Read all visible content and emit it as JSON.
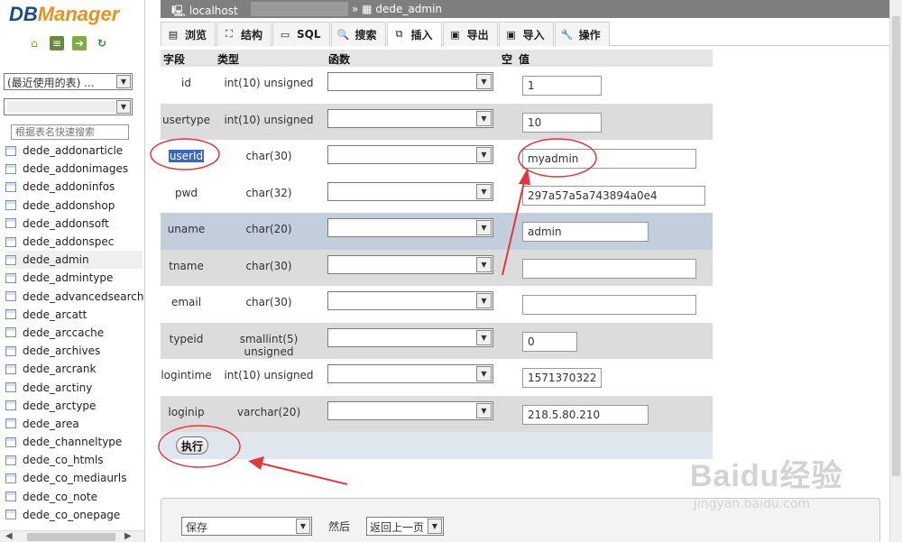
{
  "app": {
    "logo_db": "DB",
    "logo_manager": "Manager"
  },
  "sidebar": {
    "recent_select": "(最近使用的表) ...",
    "db_select": "",
    "search_placeholder": "根据表名快速搜索",
    "tables": [
      "dede_addonarticle",
      "dede_addonimages",
      "dede_addoninfos",
      "dede_addonshop",
      "dede_addonsoft",
      "dede_addonspec",
      "dede_admin",
      "dede_admintype",
      "dede_advancedsearch",
      "dede_arcatt",
      "dede_arccache",
      "dede_archives",
      "dede_arcrank",
      "dede_arctiny",
      "dede_arctype",
      "dede_area",
      "dede_channeltype",
      "dede_co_htmls",
      "dede_co_mediaurls",
      "dede_co_note",
      "dede_co_onepage"
    ],
    "active_table": "dede_admin"
  },
  "breadcrumb": {
    "server": "localhost",
    "table": "dede_admin",
    "sep": "»"
  },
  "tabs": [
    "浏览",
    "结构",
    "SQL",
    "搜索",
    "插入",
    "导出",
    "导入",
    "操作"
  ],
  "active_tab": "插入",
  "form": {
    "headers": {
      "field": "字段",
      "type": "类型",
      "function": "函数",
      "null": "空",
      "value": "值"
    },
    "rows": [
      {
        "name": "id",
        "type": "int(10) unsigned",
        "value": "1"
      },
      {
        "name": "usertype",
        "type": "int(10) unsigned",
        "value": "10"
      },
      {
        "name": "userId",
        "type": "char(30)",
        "value": "myadmin"
      },
      {
        "name": "pwd",
        "type": "char(32)",
        "value": "297a57a5a743894a0e4"
      },
      {
        "name": "uname",
        "type": "char(20)",
        "value": "admin"
      },
      {
        "name": "tname",
        "type": "char(30)",
        "value": ""
      },
      {
        "name": "email",
        "type": "char(30)",
        "value": ""
      },
      {
        "name": "typeid",
        "type": "smallint(5) unsigned",
        "value": "0"
      },
      {
        "name": "logintime",
        "type": "int(10) unsigned",
        "value": "1571370322"
      },
      {
        "name": "loginip",
        "type": "varchar(20)",
        "value": "218.5.80.210"
      }
    ],
    "execute_label": "执行"
  },
  "bottom": {
    "save_option": "保存",
    "then_label": "然后",
    "return_option": "返回上一页"
  },
  "watermark": {
    "brand": "Baidu经验",
    "url": "jingyan.baidu.com"
  },
  "colors": {
    "annotation": "#e0383e",
    "selection": "#3a67b9",
    "breadcrumb_bg": "#7f7f7f"
  }
}
